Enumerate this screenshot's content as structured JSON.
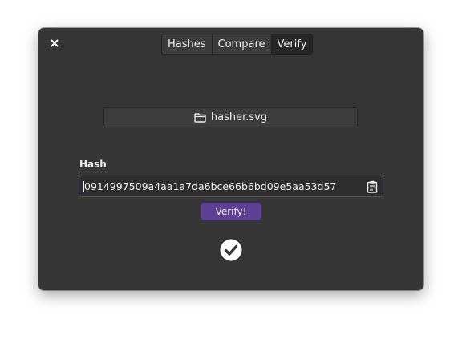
{
  "window": {
    "close_icon": "close-icon"
  },
  "tabs": [
    {
      "label": "Hashes",
      "active": false
    },
    {
      "label": "Compare",
      "active": false
    },
    {
      "label": "Verify",
      "active": true
    }
  ],
  "file_button": {
    "icon": "folder-icon",
    "label": "hasher.svg"
  },
  "hash": {
    "label": "Hash",
    "value": "0914997509a4aa1a7da6bce66b6bd09e5aa53d57",
    "paste_icon": "clipboard-icon"
  },
  "verify_button": {
    "label": "Verify!"
  },
  "result": {
    "icon": "check-circle-icon"
  },
  "colors": {
    "window_bg": "#353535",
    "accent": "#5e3f93",
    "entry_focus_border": "#5b4a86"
  }
}
